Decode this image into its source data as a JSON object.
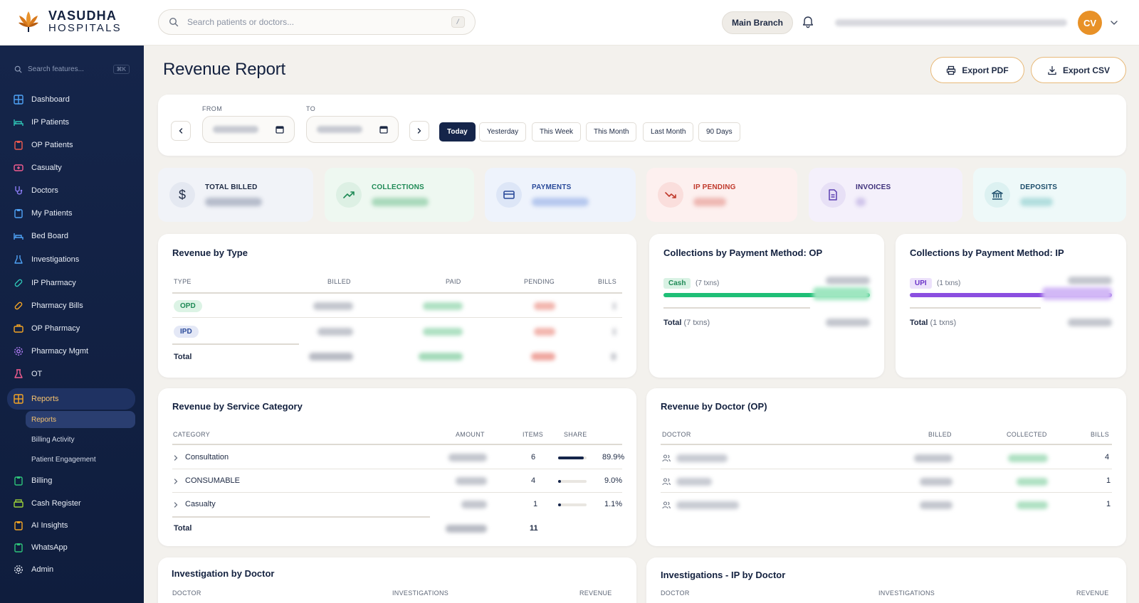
{
  "brand": {
    "line1": "VASUDHA",
    "line2": "HOSPITALS"
  },
  "header": {
    "search_placeholder": "Search patients or doctors...",
    "search_shortcut": "/",
    "branch": "Main Branch",
    "user_initials": "CV"
  },
  "sidebar": {
    "search_placeholder": "Search features...",
    "search_shortcut": "⌘K",
    "items": [
      {
        "label": "Dashboard",
        "icon": "grid-icon"
      },
      {
        "label": "IP Patients",
        "icon": "bed-icon"
      },
      {
        "label": "OP Patients",
        "icon": "clipboard-icon"
      },
      {
        "label": "Casualty",
        "icon": "ambulance-icon"
      },
      {
        "label": "Doctors",
        "icon": "stethoscope-icon"
      },
      {
        "label": "My Patients",
        "icon": "clipboard-icon"
      },
      {
        "label": "Bed Board",
        "icon": "bed-icon"
      },
      {
        "label": "Investigations",
        "icon": "flask-icon"
      },
      {
        "label": "IP Pharmacy",
        "icon": "pill-icon"
      },
      {
        "label": "Pharmacy Bills",
        "icon": "pill-icon"
      },
      {
        "label": "OP Pharmacy",
        "icon": "briefcase-icon"
      },
      {
        "label": "Pharmacy Mgmt",
        "icon": "gear-icon"
      },
      {
        "label": "OT",
        "icon": "beaker-icon"
      },
      {
        "label": "Reports",
        "icon": "grid-icon"
      }
    ],
    "report_sub": [
      "Reports",
      "Billing Activity",
      "Patient Engagement"
    ],
    "bottom_items": [
      {
        "label": "Billing",
        "icon": "clipboard-icon"
      },
      {
        "label": "Cash Register",
        "icon": "register-icon"
      },
      {
        "label": "AI Insights",
        "icon": "clipboard-icon"
      },
      {
        "label": "WhatsApp",
        "icon": "clipboard-icon"
      },
      {
        "label": "Admin",
        "icon": "gear-icon"
      }
    ]
  },
  "page": {
    "title": "Revenue Report",
    "export_pdf": "Export PDF",
    "export_csv": "Export CSV"
  },
  "filters": {
    "from_label": "FROM",
    "to_label": "TO",
    "presets": [
      "Today",
      "Yesterday",
      "This Week",
      "This Month",
      "Last Month",
      "90 Days"
    ],
    "active_preset": "Today"
  },
  "stats": [
    {
      "label": "TOTAL BILLED",
      "icon": "dollar-icon",
      "color": "#1e2a44",
      "bg": "#f1f3f8"
    },
    {
      "label": "COLLECTIONS",
      "icon": "trend-up-icon",
      "color": "#1f8a56",
      "bg": "#eef8f1"
    },
    {
      "label": "PAYMENTS",
      "icon": "card-icon",
      "color": "#2a4a9a",
      "bg": "#eef3fc"
    },
    {
      "label": "IP PENDING",
      "icon": "trend-down-icon",
      "color": "#c0392b",
      "bg": "#fdf0ef"
    },
    {
      "label": "INVOICES",
      "icon": "invoice-icon",
      "color": "#3d2f7a",
      "bg": "#f4f0fb"
    },
    {
      "label": "DEPOSITS",
      "icon": "bank-icon",
      "color": "#1d4e6b",
      "bg": "#eef9f9"
    }
  ],
  "revenue_by_type": {
    "title": "Revenue by Type",
    "columns": [
      "TYPE",
      "BILLED",
      "PAID",
      "PENDING",
      "BILLS"
    ],
    "rows": [
      {
        "type": "OPD"
      },
      {
        "type": "IPD"
      }
    ],
    "total_label": "Total"
  },
  "collections_op": {
    "title": "Collections by Payment Method: OP",
    "method": "Cash",
    "txns": "(7 txns)",
    "total_label": "Total",
    "total_txns": "(7 txns)",
    "color": "#1fbf77"
  },
  "collections_ip": {
    "title": "Collections by Payment Method: IP",
    "method": "UPI",
    "txns": "(1 txns)",
    "total_label": "Total",
    "total_txns": "(1 txns)",
    "color": "#8b4fe0"
  },
  "service_category": {
    "title": "Revenue by Service Category",
    "columns": [
      "CATEGORY",
      "AMOUNT",
      "ITEMS",
      "SHARE"
    ],
    "rows": [
      {
        "name": "Consultation",
        "items": "6",
        "share": "89.9%",
        "share_value": 0.899
      },
      {
        "name": "CONSUMABLE",
        "items": "4",
        "share": "9.0%",
        "share_value": 0.09
      },
      {
        "name": "Casualty",
        "items": "1",
        "share": "1.1%",
        "share_value": 0.011
      }
    ],
    "total_label": "Total",
    "total_items": "11"
  },
  "doctor_op": {
    "title": "Revenue by Doctor (OP)",
    "columns": [
      "DOCTOR",
      "BILLED",
      "COLLECTED",
      "BILLS"
    ],
    "rows": [
      {
        "bills": "4"
      },
      {
        "bills": "1"
      },
      {
        "bills": "1"
      }
    ]
  },
  "investigation_doctor": {
    "title": "Investigation by Doctor",
    "columns": [
      "DOCTOR",
      "INVESTIGATIONS",
      "REVENUE"
    ]
  },
  "investigations_ip": {
    "title": "Investigations - IP by Doctor",
    "columns": [
      "DOCTOR",
      "INVESTIGATIONS",
      "REVENUE"
    ]
  }
}
